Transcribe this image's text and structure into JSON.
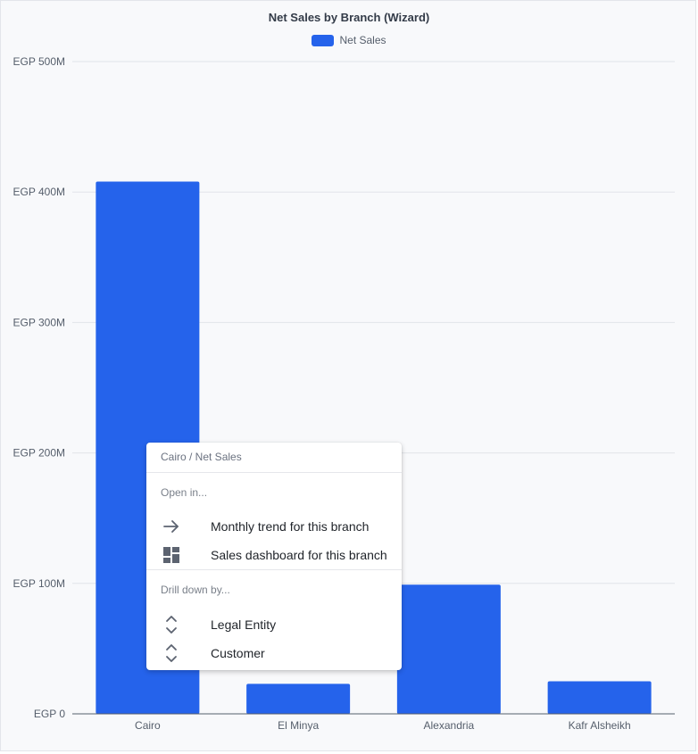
{
  "chart_data": {
    "type": "bar",
    "title": "Net Sales by Branch (Wizard)",
    "categories": [
      "Cairo",
      "El Minya",
      "Alexandria",
      "Kafr Alsheikh"
    ],
    "series": [
      {
        "name": "Net Sales",
        "values": [
          408,
          23,
          99,
          25
        ]
      }
    ],
    "ylim": [
      0,
      500
    ],
    "yticks": [
      0,
      100,
      200,
      300,
      400,
      500
    ],
    "ytick_labels": [
      "EGP 0",
      "EGP 100M",
      "EGP 200M",
      "EGP 300M",
      "EGP 400M",
      "EGP 500M"
    ],
    "grid": true,
    "legend": "top",
    "bar_color": "#2563eb"
  },
  "context_menu": {
    "header": "Cairo / Net Sales",
    "open_in_label": "Open in...",
    "open_items": [
      {
        "label": "Monthly trend for this branch",
        "icon": "arrow-right-icon"
      },
      {
        "label": "Sales dashboard for this branch",
        "icon": "dashboard-icon"
      }
    ],
    "drill_label": "Drill down by...",
    "drill_items": [
      {
        "label": "Legal Entity",
        "icon": "chevron-up-down-icon"
      },
      {
        "label": "Customer",
        "icon": "chevron-up-down-icon"
      }
    ]
  }
}
